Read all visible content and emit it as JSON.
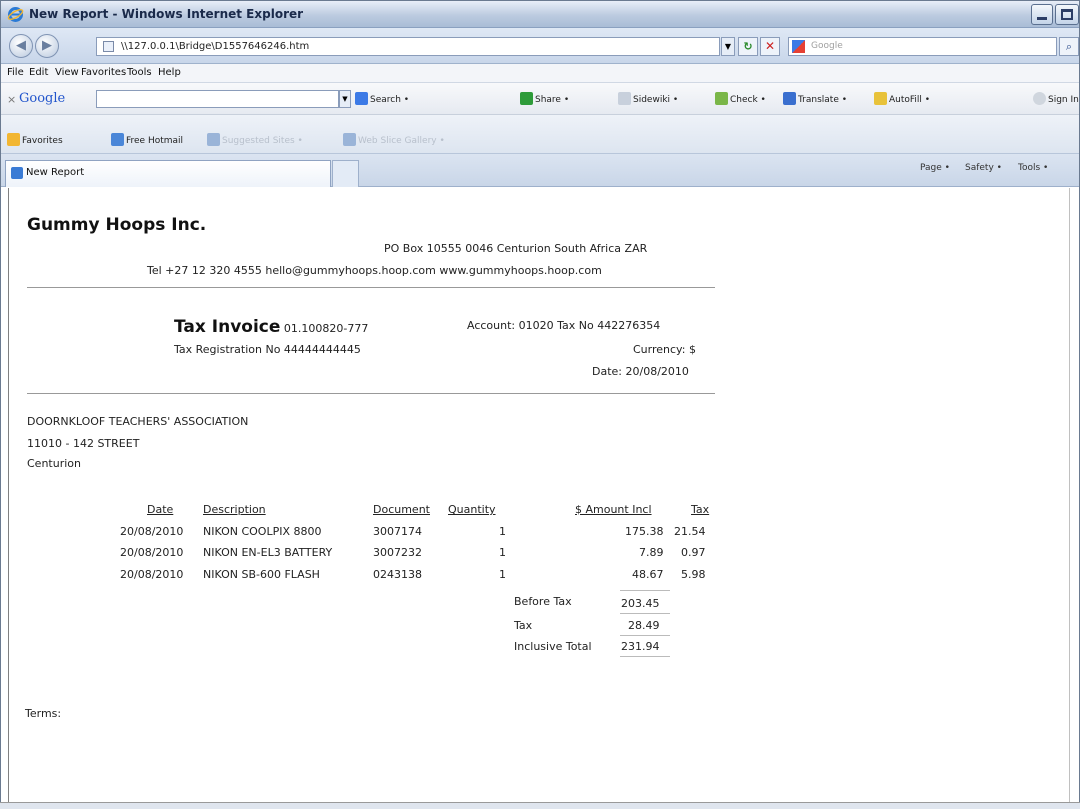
{
  "window": {
    "title": "New Report - Windows Internet Explorer"
  },
  "address": {
    "url": "\\\\127.0.0.1\\Bridge\\D1557646246.htm"
  },
  "search": {
    "placeholder": "Google"
  },
  "menu": [
    "File",
    "Edit",
    "View",
    "Favorites",
    "Tools",
    "Help"
  ],
  "google_toolbar": {
    "label": "Google",
    "items": [
      "Search •",
      "Share •",
      "Sidewiki •",
      "Check •",
      "Translate •",
      "AutoFill •",
      "Sign In"
    ]
  },
  "favorites_bar": {
    "favorites_label": "Favorites",
    "items": [
      "Free Hotmail",
      "Suggested Sites •",
      "Web Slice Gallery •"
    ]
  },
  "tab": {
    "label": "New Report"
  },
  "command_bar": [
    "Page •",
    "Safety •",
    "Tools •"
  ],
  "report": {
    "company": "Gummy Hoops Inc.",
    "address": "PO Box 10555 0046 Centurion South Africa ZAR",
    "contact": "Tel +27 12 320 4555 hello@gummyhoops.hoop.com www.gummyhoops.hoop.com",
    "doc_title": "Tax Invoice",
    "doc_number": "01.100820-777",
    "tax_reg": "Tax Registration No 44444444445",
    "account": "Account: 01020 Tax No 442276354",
    "currency": "Currency: $",
    "date": "Date: 20/08/2010",
    "customer": {
      "name": "DOORNKLOOF TEACHERS' ASSOCIATION",
      "street": "11010 - 142 STREET",
      "city": "Centurion"
    },
    "columns": {
      "date": "Date",
      "description": "Description",
      "document": "Document",
      "quantity": "Quantity",
      "amount": "$ Amount Incl",
      "tax": "Tax"
    },
    "rows": [
      {
        "date": "20/08/2010",
        "description": "NIKON COOLPIX 8800",
        "document": "3007174",
        "quantity": "1",
        "amount": "175.38",
        "tax": "21.54"
      },
      {
        "date": "20/08/2010",
        "description": "NIKON EN-EL3 BATTERY",
        "document": "3007232",
        "quantity": "1",
        "amount": "7.89",
        "tax": "0.97"
      },
      {
        "date": "20/08/2010",
        "description": "NIKON SB-600 FLASH",
        "document": "0243138",
        "quantity": "1",
        "amount": "48.67",
        "tax": "5.98"
      }
    ],
    "totals": {
      "before_tax_label": "Before Tax",
      "before_tax": "203.45",
      "tax_label": "Tax",
      "tax": "28.49",
      "inclusive_label": "Inclusive Total",
      "inclusive": "231.94"
    },
    "terms": "Terms:"
  }
}
